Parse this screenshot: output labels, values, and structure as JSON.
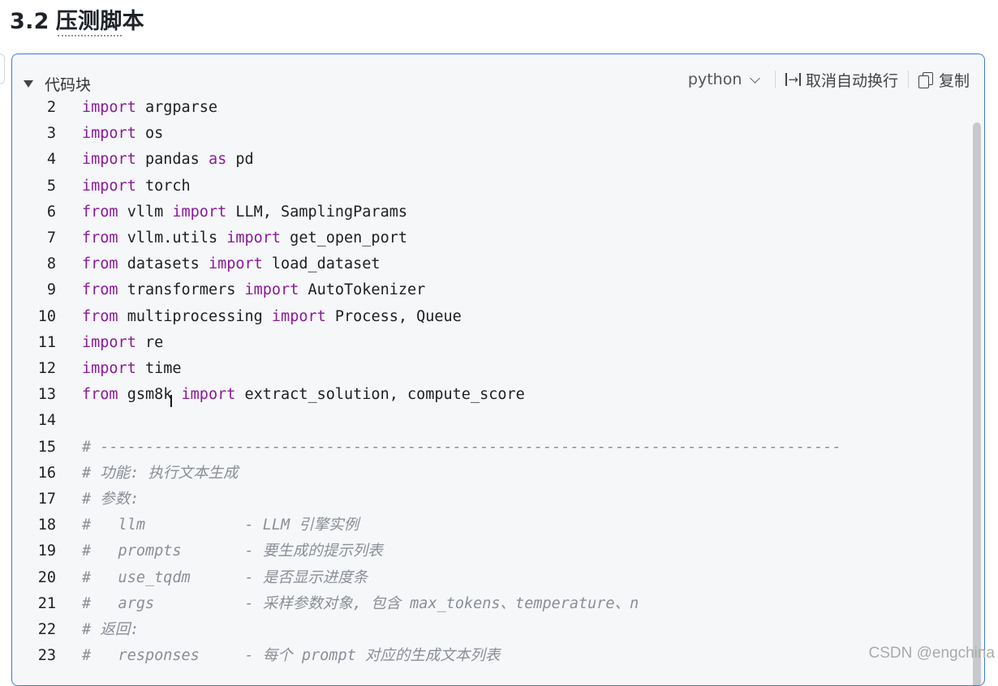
{
  "heading": {
    "number": "3.2",
    "text": "压测脚本"
  },
  "codeblock": {
    "collapse_label": "代码块",
    "language": "python",
    "wrap_label": "取消自动换行",
    "copy_label": "复制"
  },
  "code_lines": [
    {
      "n": "2",
      "parts": [
        [
          "kw",
          "import"
        ],
        [
          "t",
          " argparse"
        ]
      ]
    },
    {
      "n": "3",
      "parts": [
        [
          "kw",
          "import"
        ],
        [
          "t",
          " os"
        ]
      ]
    },
    {
      "n": "4",
      "parts": [
        [
          "kw",
          "import"
        ],
        [
          "t",
          " pandas "
        ],
        [
          "kw",
          "as"
        ],
        [
          "t",
          " pd"
        ]
      ]
    },
    {
      "n": "5",
      "parts": [
        [
          "kw",
          "import"
        ],
        [
          "t",
          " torch"
        ]
      ]
    },
    {
      "n": "6",
      "parts": [
        [
          "kw",
          "from"
        ],
        [
          "t",
          " vllm "
        ],
        [
          "kw",
          "import"
        ],
        [
          "t",
          " LLM, SamplingParams"
        ]
      ]
    },
    {
      "n": "7",
      "parts": [
        [
          "kw",
          "from"
        ],
        [
          "t",
          " vllm.utils "
        ],
        [
          "kw",
          "import"
        ],
        [
          "t",
          " get_open_port"
        ]
      ]
    },
    {
      "n": "8",
      "parts": [
        [
          "kw",
          "from"
        ],
        [
          "t",
          " datasets "
        ],
        [
          "kw",
          "import"
        ],
        [
          "t",
          " load_dataset"
        ]
      ]
    },
    {
      "n": "9",
      "parts": [
        [
          "kw",
          "from"
        ],
        [
          "t",
          " transformers "
        ],
        [
          "kw",
          "import"
        ],
        [
          "t",
          " AutoTokenizer"
        ]
      ]
    },
    {
      "n": "10",
      "parts": [
        [
          "kw",
          "from"
        ],
        [
          "t",
          " multiprocessing "
        ],
        [
          "kw",
          "import"
        ],
        [
          "t",
          " Process, Queue"
        ]
      ]
    },
    {
      "n": "11",
      "parts": [
        [
          "kw",
          "import"
        ],
        [
          "t",
          " re"
        ]
      ]
    },
    {
      "n": "12",
      "parts": [
        [
          "kw",
          "import"
        ],
        [
          "t",
          " time"
        ]
      ]
    },
    {
      "n": "13",
      "parts": [
        [
          "kw",
          "from"
        ],
        [
          "t",
          " gsm8k "
        ],
        [
          "kw",
          "import"
        ],
        [
          "t",
          " extract_solution, compute_score"
        ]
      ]
    },
    {
      "n": "14",
      "parts": []
    },
    {
      "n": "15",
      "parts": [
        [
          "cm",
          "# ----------------------------------------------------------------------------------"
        ]
      ]
    },
    {
      "n": "16",
      "parts": [
        [
          "cm",
          "# 功能: 执行文本生成"
        ]
      ]
    },
    {
      "n": "17",
      "parts": [
        [
          "cm",
          "# 参数:"
        ]
      ]
    },
    {
      "n": "18",
      "parts": [
        [
          "cm",
          "#   llm           - LLM 引擎实例"
        ]
      ]
    },
    {
      "n": "19",
      "parts": [
        [
          "cm",
          "#   prompts       - 要生成的提示列表"
        ]
      ]
    },
    {
      "n": "20",
      "parts": [
        [
          "cm",
          "#   use_tqdm      - 是否显示进度条"
        ]
      ]
    },
    {
      "n": "21",
      "parts": [
        [
          "cm",
          "#   args          - 采样参数对象, 包含 max_tokens、temperature、n"
        ]
      ]
    },
    {
      "n": "22",
      "parts": [
        [
          "cm",
          "# 返回:"
        ]
      ]
    },
    {
      "n": "23",
      "parts": [
        [
          "cm",
          "#   responses     - 每个 prompt 对应的生成文本列表"
        ]
      ]
    }
  ],
  "watermark": "CSDN @engchina"
}
